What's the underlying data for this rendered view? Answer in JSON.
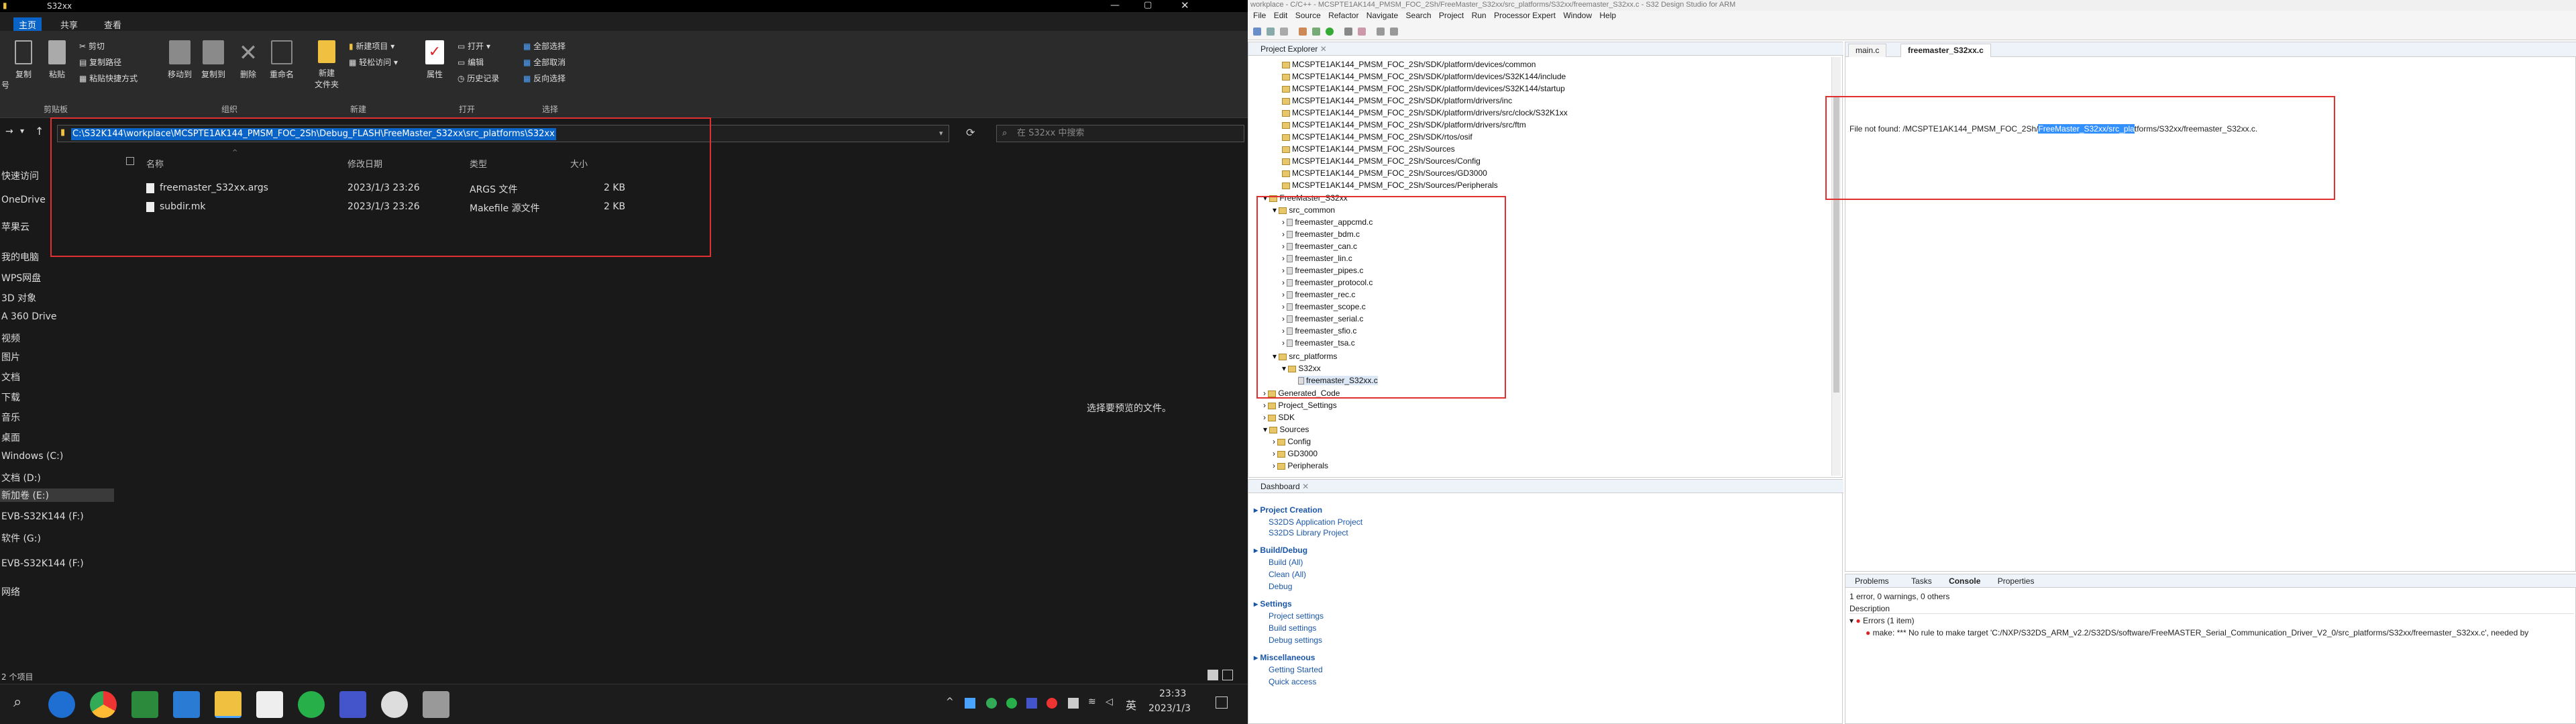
{
  "explorer": {
    "window_title": "S32xx",
    "tabs": [
      "主页",
      "共享",
      "查看"
    ],
    "ribbon": {
      "clipboard": {
        "copy_path_label": "复制",
        "paste": "粘贴",
        "cut": "剪切",
        "copy_path": "复制路径",
        "paste_shortcut": "粘贴快捷方式",
        "group": "剪贴板"
      },
      "organize": {
        "move_to": "移动到",
        "copy_to": "复制到",
        "delete": "删除",
        "rename": "重命名",
        "group": "组织"
      },
      "new": {
        "new_folder": "新建\n文件夹",
        "new_item": "新建项目 ▾",
        "easy_access": "轻松访问 ▾",
        "group": "新建"
      },
      "open": {
        "properties": "属性",
        "open": "打开 ▾",
        "edit": "编辑",
        "history": "历史记录",
        "group": "打开"
      },
      "select": {
        "select_all": "全部选择",
        "select_none": "全部取消",
        "invert": "反向选择",
        "group": "选择"
      },
      "left_fragment": "号"
    },
    "address": {
      "path": "C:\\S32K144\\workplace\\MCSPTE1AK144_PMSM_FOC_2Sh\\Debug_FLASH\\FreeMaster_S32xx\\src_platforms\\S32xx",
      "search_placeholder": "在 S32xx 中搜索"
    },
    "columns": {
      "name": "名称",
      "modified": "修改日期",
      "type": "类型",
      "size": "大小"
    },
    "files": [
      {
        "name": "freemaster_S32xx.args",
        "modified": "2023/1/3 23:26",
        "type": "ARGS 文件",
        "size": "2 KB"
      },
      {
        "name": "subdir.mk",
        "modified": "2023/1/3 23:26",
        "type": "Makefile 源文件",
        "size": "2 KB"
      }
    ],
    "preview_hint": "选择要预览的文件。",
    "nav": [
      "快速访问",
      "OneDrive",
      "苹果云",
      "我的电脑",
      "WPS网盘",
      "3D 对象",
      "A 360 Drive",
      "视频",
      "图片",
      "文档",
      "下载",
      "音乐",
      "桌面",
      "Windows (C:)",
      "文档 (D:)",
      "新加卷 (E:)",
      "EVB-S32K144 (F:)",
      "软件 (G:)",
      "EVB-S32K144 (F:)",
      "网络"
    ],
    "status": "2 个项目",
    "clock": {
      "time": "23:33",
      "date": "2023/1/3"
    },
    "ime": "英"
  },
  "eclipse": {
    "title": "workplace - C/C++ - MCSPTE1AK144_PMSM_FOC_2Sh/FreeMaster_S32xx/src_platforms/S32xx/freemaster_S32xx.c - S32 Design Studio for ARM",
    "menu": [
      "File",
      "Edit",
      "Source",
      "Refactor",
      "Navigate",
      "Search",
      "Project",
      "Run",
      "Processor Expert",
      "Window",
      "Help"
    ],
    "project_explorer": "Project Explorer",
    "tree": [
      "MCSPTE1AK144_PMSM_FOC_2Sh/SDK/platform/devices/common",
      "MCSPTE1AK144_PMSM_FOC_2Sh/SDK/platform/devices/S32K144/include",
      "MCSPTE1AK144_PMSM_FOC_2Sh/SDK/platform/devices/S32K144/startup",
      "MCSPTE1AK144_PMSM_FOC_2Sh/SDK/platform/drivers/inc",
      "MCSPTE1AK144_PMSM_FOC_2Sh/SDK/platform/drivers/src/clock/S32K1xx",
      "MCSPTE1AK144_PMSM_FOC_2Sh/SDK/platform/drivers/src/ftm",
      "MCSPTE1AK144_PMSM_FOC_2Sh/SDK/rtos/osif",
      "MCSPTE1AK144_PMSM_FOC_2Sh/Sources",
      "MCSPTE1AK144_PMSM_FOC_2Sh/Sources/Config",
      "MCSPTE1AK144_PMSM_FOC_2Sh/Sources/GD3000",
      "MCSPTE1AK144_PMSM_FOC_2Sh/Sources/Peripherals"
    ],
    "fm_root": "FreeMaster_S32xx",
    "src_common": "src_common",
    "fm_files": [
      "freemaster_appcmd.c",
      "freemaster_bdm.c",
      "freemaster_can.c",
      "freemaster_lin.c",
      "freemaster_pipes.c",
      "freemaster_protocol.c",
      "freemaster_rec.c",
      "freemaster_scope.c",
      "freemaster_serial.c",
      "freemaster_sfio.c",
      "freemaster_tsa.c"
    ],
    "src_platforms": "src_platforms",
    "s32xx": "S32xx",
    "fm_s32xx": "freemaster_S32xx.c",
    "other_nodes": [
      "Generated_Code",
      "Project_Settings",
      "SDK",
      "Sources",
      "Config",
      "GD3000",
      "Peripherals"
    ],
    "dashboard": {
      "title": "Dashboard",
      "project_creation": "Project Creation",
      "pc_links": [
        "S32DS Application Project",
        "S32DS Library Project"
      ],
      "build_debug": "Build/Debug",
      "bd_links": [
        "Build  (All)",
        "Clean  (All)",
        "Debug"
      ],
      "settings": "Settings",
      "s_links": [
        "Project settings",
        "Build settings",
        "Debug settings"
      ],
      "misc": "Miscellaneous",
      "m_links": [
        "Getting Started",
        "Quick access"
      ]
    },
    "editor_tabs": [
      "main.c",
      "freemaster_S32xx.c"
    ],
    "file_not_found_prefix": "File not found: /MCSPTE1AK144_PMSM_FOC_2Sh/",
    "file_not_found_hl": "FreeMaster_S32xx/src_pla",
    "file_not_found_suffix": "tforms/S32xx/freemaster_S32xx.c.",
    "problems_tabs": [
      "Problems",
      "Tasks",
      "Console",
      "Properties"
    ],
    "problems_summary": "1 error, 0 warnings, 0 others",
    "desc_header": "Description",
    "errors_group": "Errors (1 item)",
    "error_text": "make: *** No rule to make target 'C:/NXP/S32DS_ARM_v2.2/S32DS/software/FreeMASTER_Serial_Communication_Driver_V2_0/src_platforms/S32xx/freemaster_S32xx.c', needed by"
  }
}
